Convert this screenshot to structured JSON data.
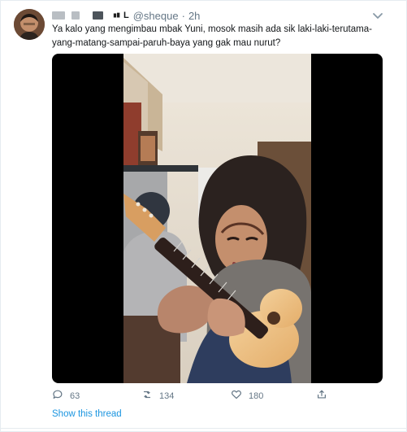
{
  "tweet": {
    "handle": "@sheque",
    "name_suffix": "L",
    "separator": "·",
    "time": "2h",
    "text": "Ya kalo yang mengimbau mbak Yuni, mosok masih ada sik laki-laki-terutama-yang-matang-sampai-paruh-baya yang gak mau nurut?"
  },
  "actions": {
    "reply_count": "63",
    "retweet_count": "134",
    "like_count": "180"
  },
  "thread_link": "Show this thread",
  "icons": {
    "avatar": "avatar",
    "verified_like_mark": "verified-icon",
    "menu": "chevron-down-icon",
    "reply": "reply-icon",
    "retweet": "retweet-icon",
    "like": "heart-icon",
    "share": "share-icon"
  },
  "colors": {
    "accent": "#1b95e0",
    "muted": "#657786",
    "border": "#e6ecf0",
    "video_bg": "#000000"
  }
}
